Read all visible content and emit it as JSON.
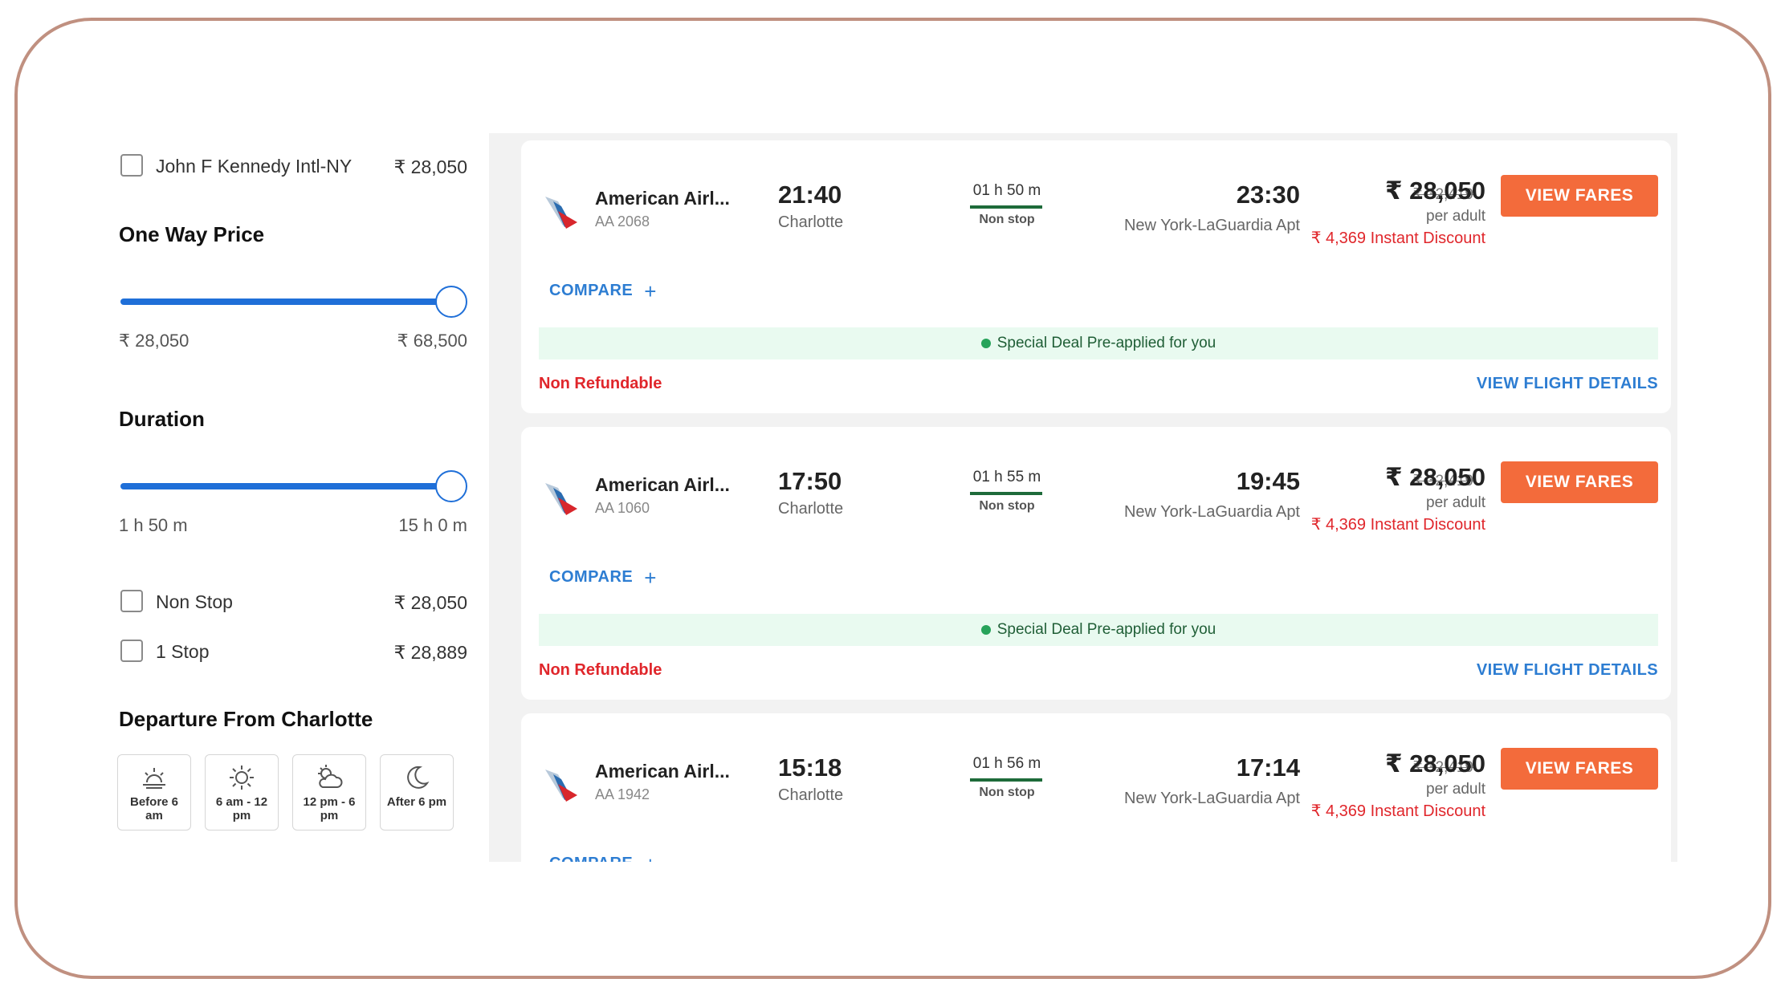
{
  "filters": {
    "airport_option": {
      "label": "John F Kennedy Intl-NY",
      "price": "₹ 28,050"
    },
    "one_way_price": {
      "title": "One Way Price",
      "min": "₹ 28,050",
      "max": "₹ 68,500",
      "slider_value": 1.0
    },
    "duration": {
      "title": "Duration",
      "min": "1 h 50 m",
      "max": "15 h 0 m",
      "slider_value": 1.0
    },
    "stops": [
      {
        "label": "Non Stop",
        "price": "₹ 28,050"
      },
      {
        "label": "1 Stop",
        "price": "₹ 28,889"
      }
    ],
    "departure": {
      "title": "Departure From Charlotte",
      "slots": [
        {
          "label": "Before 6 am",
          "icon": "sunrise-icon"
        },
        {
          "label": "6 am - 12 pm",
          "icon": "sun-icon"
        },
        {
          "label": "12 pm - 6 pm",
          "icon": "cloud-sun-icon"
        },
        {
          "label": "After 6 pm",
          "icon": "moon-icon"
        }
      ]
    }
  },
  "flights": [
    {
      "airline": "American Airl...",
      "code": "AA 2068",
      "dep_time": "21:40",
      "dep_city": "Charlotte",
      "duration": "01 h 50 m",
      "stops": "Non stop",
      "arr_time": "23:30",
      "arr_city": "New York-LaGuardia Apt",
      "old_price": "₹ 32,419",
      "price": "₹ 28,050",
      "per_adult": "per adult",
      "discount": "₹ 4,369 Instant Discount",
      "view_fares": "VIEW FARES",
      "compare": "COMPARE",
      "deal": "Special Deal Pre-applied for you",
      "refund": "Non Refundable",
      "details": "VIEW FLIGHT DETAILS"
    },
    {
      "airline": "American Airl...",
      "code": "AA 1060",
      "dep_time": "17:50",
      "dep_city": "Charlotte",
      "duration": "01 h 55 m",
      "stops": "Non stop",
      "arr_time": "19:45",
      "arr_city": "New York-LaGuardia Apt",
      "old_price": "₹ 32,419",
      "price": "₹ 28,050",
      "per_adult": "per adult",
      "discount": "₹ 4,369 Instant Discount",
      "view_fares": "VIEW FARES",
      "compare": "COMPARE",
      "deal": "Special Deal Pre-applied for you",
      "refund": "Non Refundable",
      "details": "VIEW FLIGHT DETAILS"
    },
    {
      "airline": "American Airl...",
      "code": "AA 1942",
      "dep_time": "15:18",
      "dep_city": "Charlotte",
      "duration": "01 h 56 m",
      "stops": "Non stop",
      "arr_time": "17:14",
      "arr_city": "New York-LaGuardia Apt",
      "old_price": "₹ 32,419",
      "price": "₹ 28,050",
      "per_adult": "per adult",
      "discount": "₹ 4,369 Instant Discount",
      "view_fares": "VIEW FARES",
      "compare": "COMPARE"
    }
  ],
  "colors": {
    "accent": "#1f6fd8",
    "cta": "#f36b3b",
    "discount": "#e0262b",
    "link": "#2d7dd2",
    "deal_bg": "#e9faf0"
  }
}
